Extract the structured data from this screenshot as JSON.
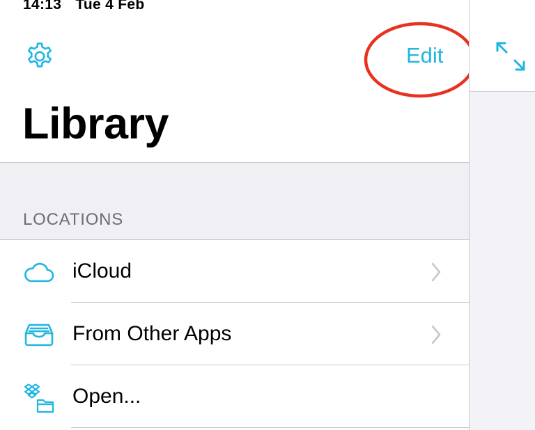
{
  "status_bar": {
    "time": "14:13",
    "date": "Tue 4 Feb"
  },
  "nav": {
    "edit_label": "Edit"
  },
  "header": {
    "title": "Library"
  },
  "locations": {
    "header": "LOCATIONS",
    "items": [
      {
        "label": "iCloud",
        "icon": "cloud-icon",
        "chevron": true
      },
      {
        "label": "From Other Apps",
        "icon": "inbox-tray-icon",
        "chevron": true
      },
      {
        "label": "Open...",
        "icon": "dropbox-folder-icon",
        "chevron": false
      }
    ]
  },
  "colors": {
    "accent": "#1fb6e0",
    "annotation": "#e8321f",
    "grouped_background": "#efeff4",
    "separator": "#c8c7cc",
    "chevron": "#c7c7cc"
  }
}
